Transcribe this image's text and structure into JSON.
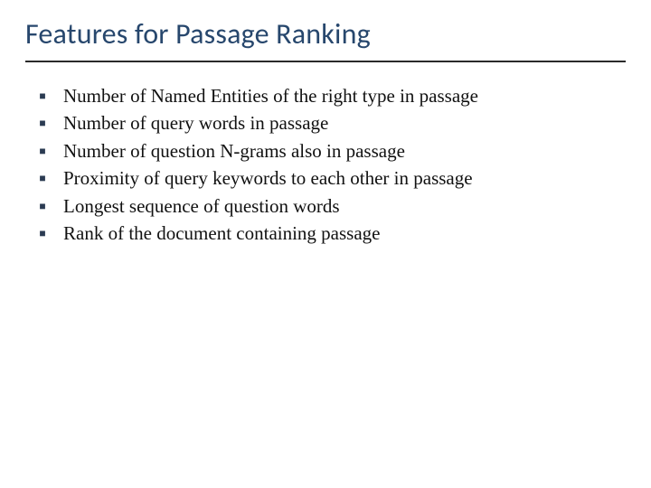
{
  "title": "Features for Passage Ranking",
  "bullets": [
    "Number of Named Entities of the right type in passage",
    "Number of query words in passage",
    "Number of question N-grams also in passage",
    "Proximity of query keywords to each other in passage",
    "Longest sequence of question words",
    "Rank of the document containing passage"
  ]
}
